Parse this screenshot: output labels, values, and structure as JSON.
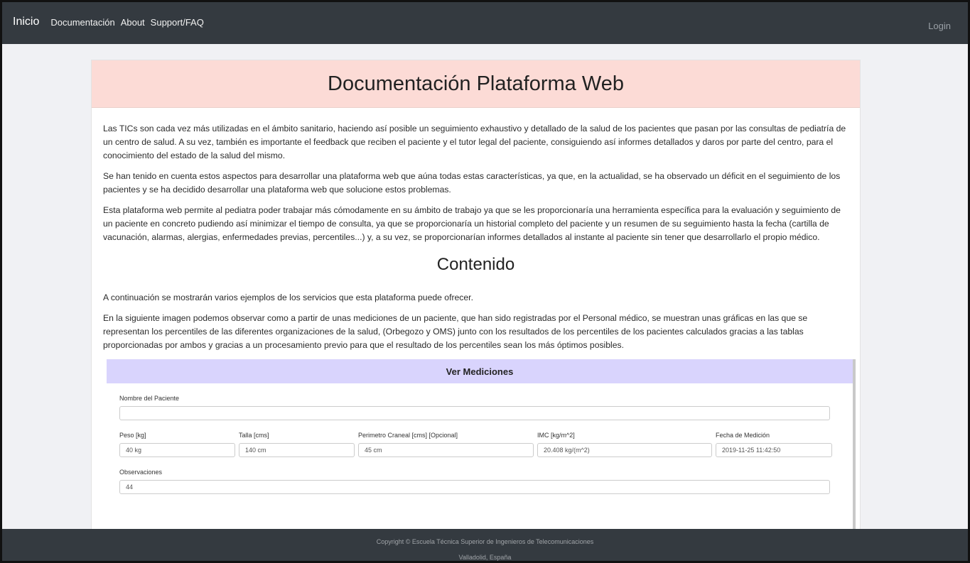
{
  "nav": {
    "brand": "Inicio",
    "links": [
      "Documentación",
      "About",
      "Support/FAQ"
    ],
    "login": "Login"
  },
  "card": {
    "title": "Documentación Plataforma Web",
    "paragraphs": [
      "Las TICs son cada vez más utilizadas en el ámbito sanitario, haciendo así posible un seguimiento exhaustivo y detallado de la salud de los pacientes que pasan por las consultas de pediatría de un centro de salud. A su vez, también es importante el feedback que reciben el paciente y el tutor legal del paciente, consiguiendo así informes detallados y daros por parte del centro, para el conocimiento del estado de la salud del mismo.",
      "Se han tenido en cuenta estos aspectos para desarrollar una plataforma web que aúna todas estas características, ya que, en la actualidad, se ha observado un déficit en el seguimiento de los pacientes y se ha decidido desarrollar una plataforma web que solucione estos problemas.",
      "Esta plataforma web permite al pediatra poder trabajar más cómodamente en su ámbito de trabajo ya que se les proporcionaría una herramienta específica para la evaluación y seguimiento de un paciente en concreto pudiendo así minimizar el tiempo de consulta, ya que se proporcionaría un historial completo del paciente y un resumen de su seguimiento hasta la fecha (cartilla de vacunación, alarmas, alergias, enfermedades previas, percentiles...) y, a su vez, se proporcionarían informes detallados al instante al paciente sin tener que desarrollarlo el propio médico."
    ],
    "section_title": "Contenido",
    "paragraphs2": [
      "A continuación se mostrarán varios ejemplos de los servicios que esta plataforma puede ofrecer.",
      "En la siguiente imagen podemos observar como a partir de unas mediciones de un paciente, que han sido registradas por el Personal médico, se muestran unas gráficas en las que se representan los percentiles de las diferentes organizaciones de la salud, (Orbegozo y OMS) junto con los resultados de los percentiles de los pacientes calculados gracias a las tablas proporcionadas por ambos y gracias a un procesamiento previo para que el resultado de los percentiles sean los más óptimos posibles."
    ]
  },
  "screenshot": {
    "title": "Ver Mediciones",
    "patient_label": "Nombre del Paciente",
    "patient_value": "",
    "fields": [
      {
        "label": "Peso [kg]",
        "value": "40 kg"
      },
      {
        "label": "Talla [cms]",
        "value": "140 cm"
      },
      {
        "label": "Perimetro Craneal [cms] [Opcional]",
        "value": "45 cm"
      },
      {
        "label": "IMC [kg/m^2]",
        "value": "20.408 kg/(m^2)"
      },
      {
        "label": "Fecha de Medición",
        "value": "2019-11-25 11:42:50"
      }
    ],
    "obs_label": "Observaciones",
    "obs_value": "44"
  },
  "footer": {
    "line1": "Copyright © Escuela Técnica Superior de Ingenieros de Telecomunicaciones",
    "line2": "Valladolid, España"
  }
}
